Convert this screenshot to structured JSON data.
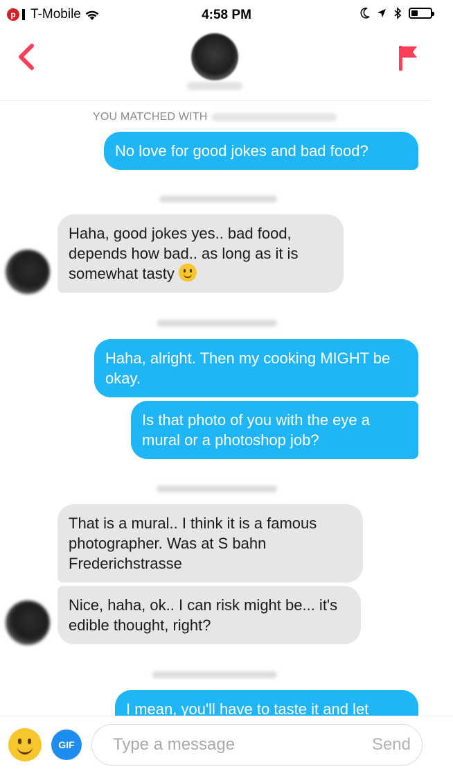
{
  "status_bar": {
    "carrier": "T-Mobile",
    "time": "4:58 PM",
    "icons": [
      "pinterest-icon",
      "signal-icon",
      "wifi-icon",
      "moon-icon",
      "location-icon",
      "bluetooth-icon",
      "battery-icon"
    ]
  },
  "header": {
    "back_icon": "chevron-left-icon",
    "flag_icon": "flag-icon",
    "accent_color": "#fd3f59"
  },
  "chat": {
    "matched_label": "YOU MATCHED WITH",
    "messages": [
      {
        "side": "out",
        "text": "No love for good jokes and bad food?"
      },
      {
        "side": "in",
        "text": "Haha, good jokes yes.. bad food, depends how bad.. as long as it is somewhat tasty"
      },
      {
        "side": "out",
        "text": "Haha, alright. Then my cooking MIGHT be okay."
      },
      {
        "side": "out",
        "text": "Is that photo of you with the eye a mural or a photoshop job?"
      },
      {
        "side": "in",
        "text": "That is a mural.. I think it is a famous photographer. Was at S bahn Frederichstrasse"
      },
      {
        "side": "in",
        "text": "Nice, haha, ok.. I can risk might be... it's edible thought, right?"
      },
      {
        "side": "out",
        "text": "I mean, you'll have to taste it and let"
      }
    ],
    "outgoing_color": "#1fb5f6",
    "incoming_color": "#e6e6e6"
  },
  "input_bar": {
    "gif_label": "GIF",
    "placeholder": "Type a message",
    "send_label": "Send"
  }
}
